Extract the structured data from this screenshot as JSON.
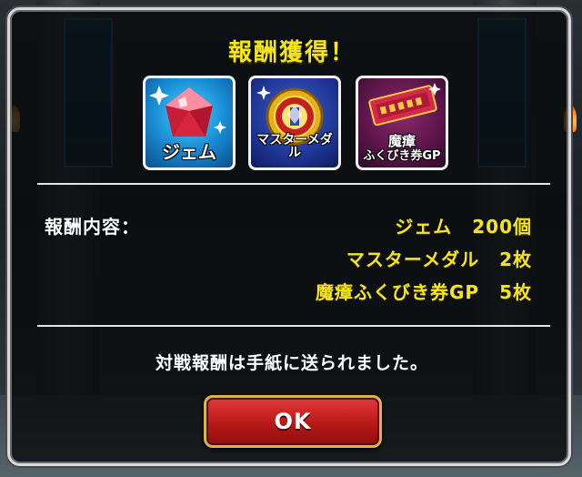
{
  "dialog": {
    "title": "報酬獲得！",
    "items": [
      {
        "caption": "ジェム",
        "icon": "gem-icon"
      },
      {
        "caption": "マスターメダル",
        "icon": "master-medal-icon"
      },
      {
        "caption_line1": "魔瘴",
        "caption_line2": "ふくびき券GP",
        "icon": "lottery-ticket-icon"
      }
    ],
    "rewards_label": "報酬内容：",
    "rewards": [
      {
        "name": "ジェム",
        "qty": "200個"
      },
      {
        "name": "マスターメダル",
        "qty": "2枚"
      },
      {
        "name": "魔瘴ふくびき券GP",
        "qty": "5枚"
      }
    ],
    "note": "対戦報酬は手紙に送られました。",
    "ok_label": "OK"
  },
  "colors": {
    "title": "#f4e51e",
    "reward_text": "#f4e51e",
    "ok_button": "#c41f1f",
    "border": "#d9d9d9"
  }
}
